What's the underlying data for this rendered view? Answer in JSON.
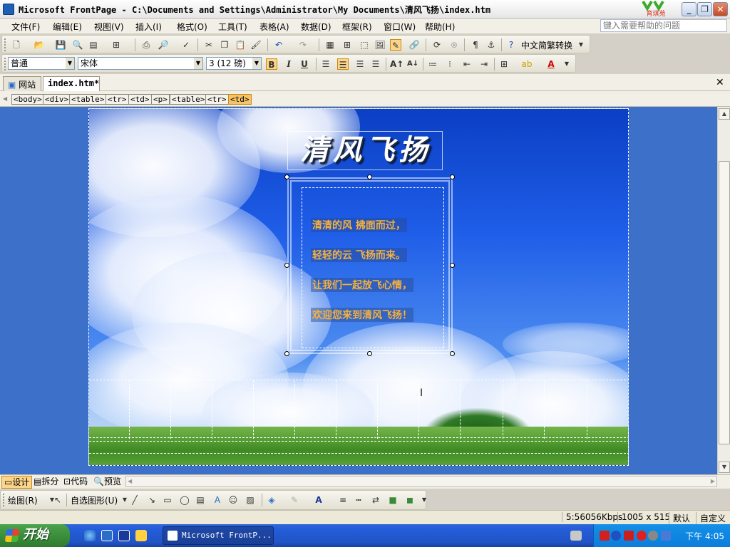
{
  "window": {
    "title": "Microsoft FrontPage - C:\\Documents and Settings\\Administrator\\My Documents\\清风飞扬\\index.htm",
    "logo_text": "育琪苑"
  },
  "menubar": {
    "items": [
      "文件(F)",
      "编辑(E)",
      "视图(V)",
      "插入(I)",
      "格式(O)",
      "工具(T)",
      "表格(A)",
      "数据(D)",
      "框架(R)",
      "窗口(W)",
      "帮助(H)"
    ],
    "help_placeholder": "键入需要帮助的问题"
  },
  "toolbar_standard": {
    "conversion_label": "中文简繁转换"
  },
  "toolbar_format": {
    "style_value": "普通",
    "font_value": "宋体",
    "size_value": "3 (12 磅)",
    "bold": "B",
    "italic": "I",
    "underline": "U"
  },
  "tabs": [
    {
      "label": "网站"
    },
    {
      "label": "index.htm*"
    }
  ],
  "tag_selector": [
    "<body>",
    "<div>",
    "<table>",
    "<tr>",
    "<td>",
    "<p>",
    "<table>",
    "<tr>",
    "<td>"
  ],
  "page_content": {
    "title": "清风飞扬",
    "poem": [
      "清清的风  拂面而过，",
      "轻轻的云  飞扬而来。",
      "让我们一起放飞心情，",
      "欢迎您来到清风飞扬！"
    ]
  },
  "view_tabs": [
    "设计",
    "拆分",
    "代码",
    "预览"
  ],
  "drawing_toolbar": {
    "draw_label": "绘图(R)",
    "autoshapes_label": "自选图形(U)"
  },
  "statusbar": {
    "speed": "5:56056Kbps",
    "dimensions": "1005 x 515",
    "mode1": "默认",
    "mode2": "自定义"
  },
  "taskbar": {
    "start_label": "开始",
    "task_label": "Microsoft FrontP...",
    "clock": "下午 4:05"
  },
  "colors": {
    "poem_text": "#f6b13a",
    "sky": "#1f5ee8",
    "taskbar": "#245edb"
  }
}
